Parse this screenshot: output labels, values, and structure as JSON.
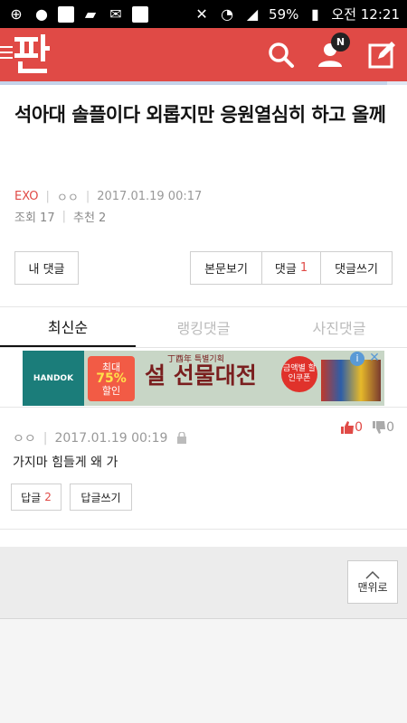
{
  "status_bar": {
    "battery": "59%",
    "time": "오전 12:21",
    "left_icons": [
      "plus-icon",
      "dot-icon",
      "facebook-icon",
      "chat-icon",
      "mail-icon",
      "pann-icon"
    ],
    "right_icons": [
      "mute-icon",
      "wifi-icon",
      "signal-icon",
      "battery-icon"
    ]
  },
  "header": {
    "logo": "판",
    "notification_badge": "N",
    "brand_color": "#e04a46"
  },
  "reading_progress": 0.95,
  "post": {
    "title": "석아대 솔플이다 외롭지만 응원열심히 하고 올께",
    "channel": "EXO",
    "author": "ㅇㅇ",
    "date": "2017.01.19 00:17",
    "views_label": "조회 17",
    "recommend_label": "추천 2"
  },
  "buttons": {
    "my_comments": "내 댓글",
    "view_post": "본문보기",
    "comments_label": "댓글",
    "comments_count": "1",
    "write_comment": "댓글쓰기"
  },
  "tabs": [
    {
      "label": "최신순",
      "active": true
    },
    {
      "label": "랭킹댓글",
      "active": false
    },
    {
      "label": "사진댓글",
      "active": false
    }
  ],
  "ad": {
    "brand": "HANDOK",
    "sale_top": "최대",
    "sale_pct": "75%",
    "sale_bottom": "할인",
    "small_text": "丁酉年 특별기획",
    "headline": "설 선물대전",
    "coupon": "금액별 할인쿠폰"
  },
  "comment": {
    "author": "ㅇㅇ",
    "date": "2017.01.19 00:19",
    "text": "가지마 힘들게 왜 가",
    "up_votes": "0",
    "down_votes": "0",
    "reply_label": "답글",
    "reply_count": "2",
    "write_reply": "답글쓰기"
  },
  "scroll_top": "맨위로"
}
